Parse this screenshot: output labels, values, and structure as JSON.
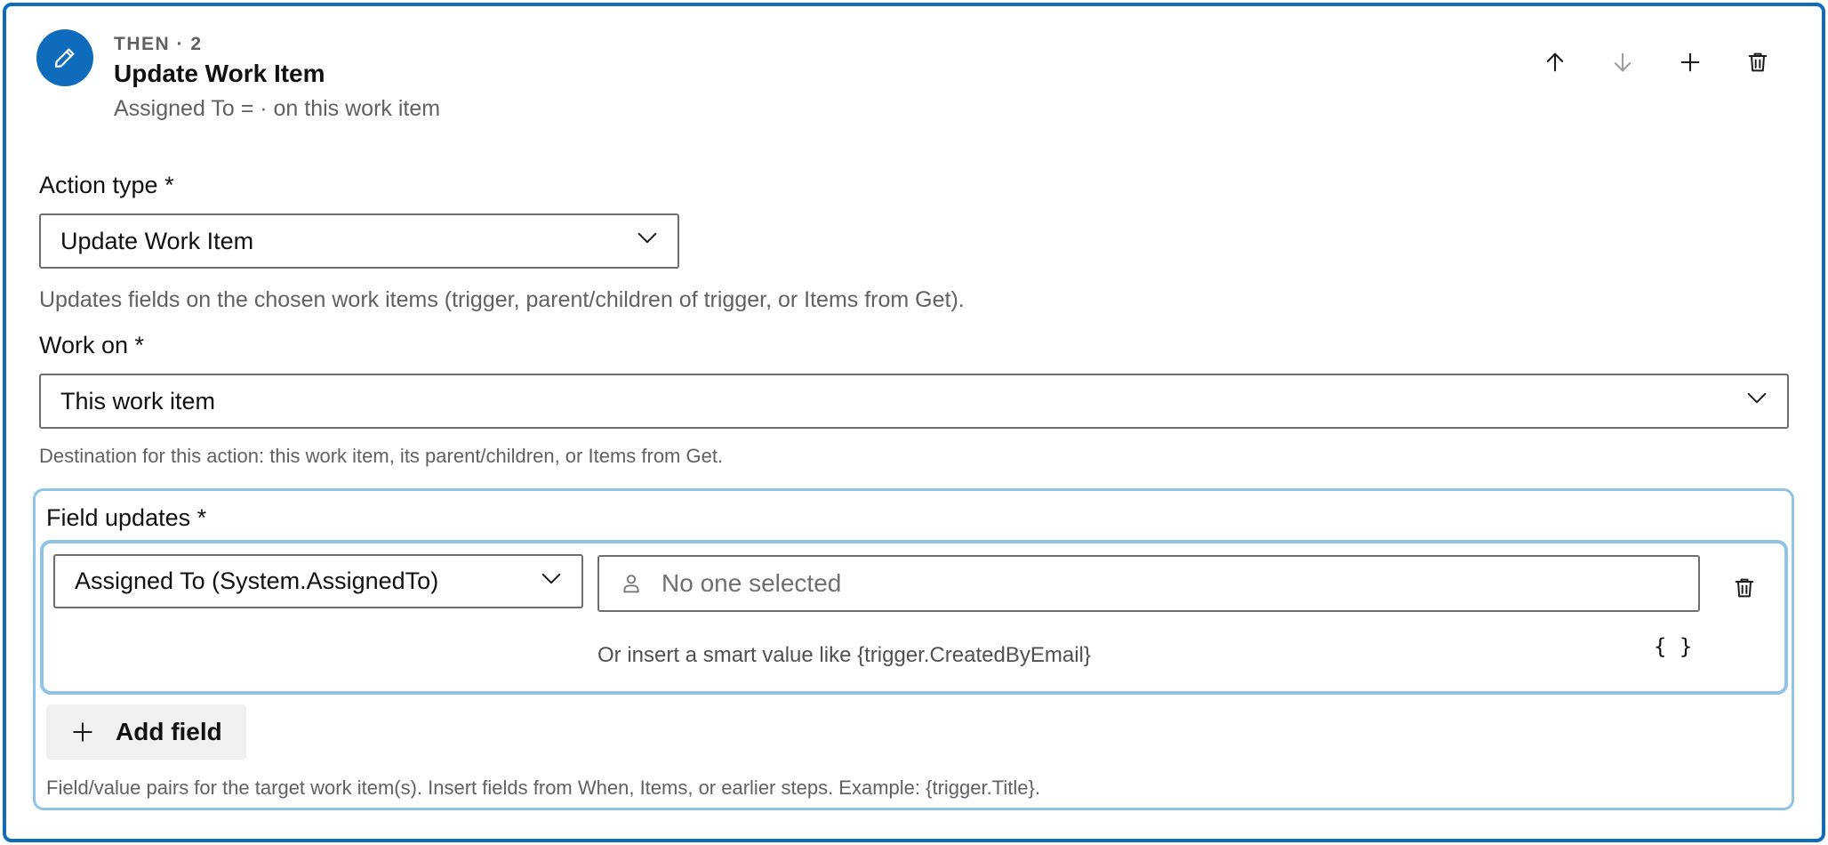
{
  "step": {
    "kind": "THEN · 2",
    "title": "Update Work Item",
    "summary": "Assigned To = · on this work item",
    "icon": "pencil-icon",
    "accent_color": "#0f6cbd"
  },
  "toolbar": {
    "move_up": "arrow-up-icon",
    "move_down": "arrow-down-icon",
    "add": "plus-icon",
    "delete": "trash-icon"
  },
  "action_type": {
    "label": "Action type *",
    "value": "Update Work Item",
    "description": "Updates fields on the chosen work items (trigger, parent/children of trigger, or Items from Get)."
  },
  "work_on": {
    "label": "Work on *",
    "value": "This work item",
    "description": "Destination for this action: this work item, its parent/children, or Items from Get."
  },
  "field_updates": {
    "label": "Field updates *",
    "rows": [
      {
        "field": "Assigned To (System.AssignedTo)",
        "value_placeholder": "No one selected",
        "smart_hint": "Or insert a smart value like {trigger.CreatedByEmail}",
        "smart_button": "{ }"
      }
    ],
    "add_field_label": "Add field",
    "description": "Field/value pairs for the target work item(s). Insert fields from When, Items, or earlier steps. Example: {trigger.Title}."
  }
}
